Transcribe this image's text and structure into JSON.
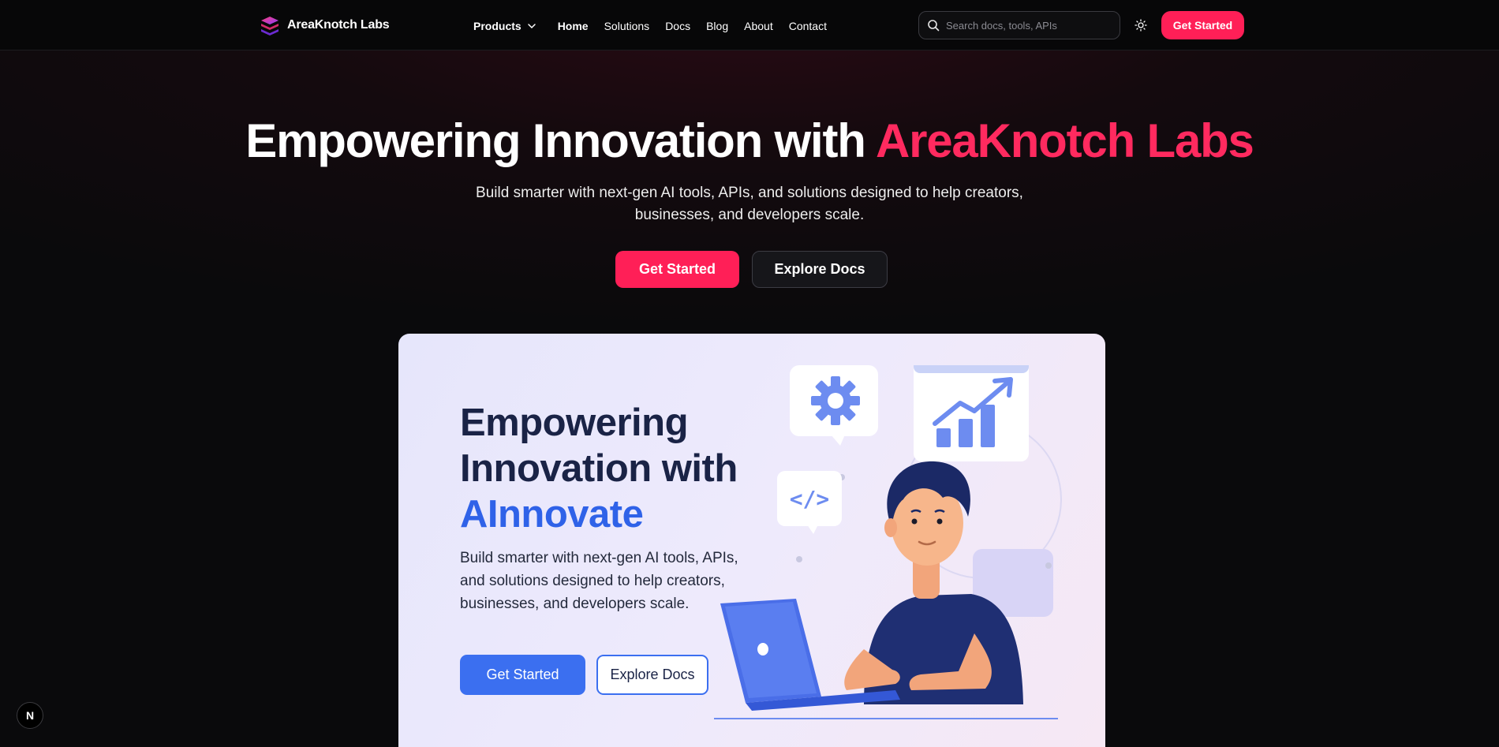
{
  "brand": {
    "name": "AreaKnotch Labs"
  },
  "nav": {
    "products": "Products",
    "home": "Home",
    "solutions": "Solutions",
    "docs": "Docs",
    "blog": "Blog",
    "about": "About",
    "contact": "Contact"
  },
  "search": {
    "placeholder": "Search docs, tools, APIs"
  },
  "header_cta": "Get Started",
  "hero": {
    "title_prefix": "Empowering Innovation with ",
    "title_accent": "AreaKnotch Labs",
    "subtitle": "Build smarter with next-gen AI tools, APIs, and solutions designed to help creators, businesses, and developers scale.",
    "primary_button": "Get Started",
    "secondary_button": "Explore Docs"
  },
  "card": {
    "title_line1": "Empowering",
    "title_line2": "Innovation with",
    "title_accent": "AInnovate",
    "subtitle": "Build smarter with next-gen AI tools, APIs, and solutions designed to help creators, businesses, and developers scale.",
    "primary_button": "Get Started",
    "secondary_button": "Explore Docs",
    "code_symbol": "</>"
  },
  "badge": "N",
  "icons": {
    "logo": "layered-cube-logo",
    "chevron": "chevron-down-icon",
    "search": "search-icon",
    "theme": "sun-icon"
  },
  "colors": {
    "accent": "#ff1f57",
    "card_blue": "#3b6ff0",
    "navy": "#1a2346"
  }
}
